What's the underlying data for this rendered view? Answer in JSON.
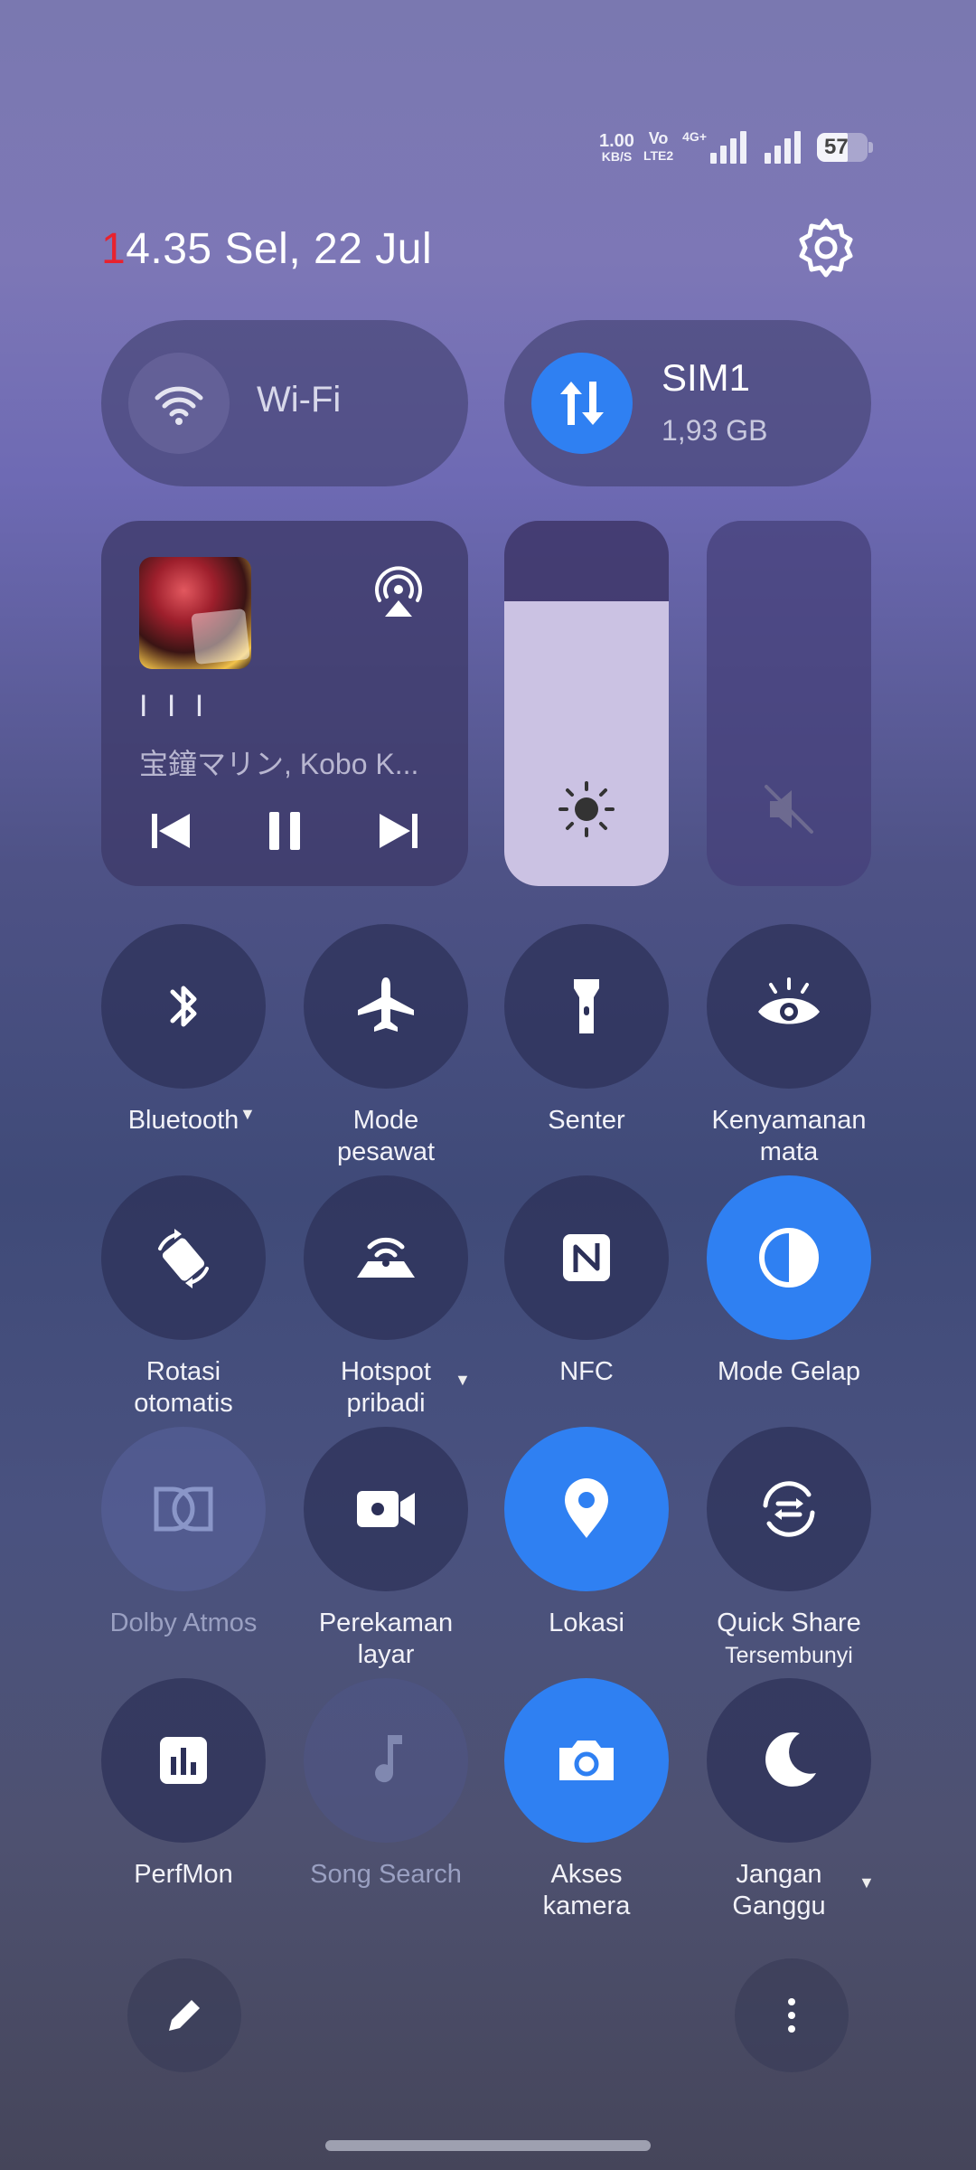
{
  "status_bar": {
    "speed_value": "1.00",
    "speed_unit": "KB/S",
    "volte_top": "Vo",
    "volte_bottom": "LTE2",
    "network": "4G+",
    "battery": "57"
  },
  "header": {
    "time_first_digit": "1",
    "time_rest": "4.35",
    "date": "Sel, 22 Jul"
  },
  "wifi": {
    "label": "Wi-Fi"
  },
  "sim": {
    "title": "SIM1",
    "usage": "1,93 GB"
  },
  "media": {
    "title": "I I I",
    "artist": "宝鐘マリン, Kobo K..."
  },
  "sliders": {
    "brightness_level": 0.78
  },
  "tiles": {
    "bluetooth": "Bluetooth",
    "airplane_1": "Mode",
    "airplane_2": "pesawat",
    "flashlight": "Senter",
    "eye_1": "Kenyamanan",
    "eye_2": "mata",
    "rotate_1": "Rotasi",
    "rotate_2": "otomatis",
    "hotspot_1": "Hotspot",
    "hotspot_2": "pribadi",
    "nfc": "NFC",
    "dark": "Mode Gelap",
    "dolby": "Dolby Atmos",
    "record_1": "Perekaman",
    "record_2": "layar",
    "location": "Lokasi",
    "share_1": "Quick Share",
    "share_2": "Tersembunyi",
    "perfmon": "PerfMon",
    "song": "Song Search",
    "camera_1": "Akses",
    "camera_2": "kamera",
    "dnd_1": "Jangan",
    "dnd_2": "Ganggu"
  },
  "colors": {
    "accent": "#2f80f2",
    "clock_red": "#e8222e"
  },
  "icons": [
    "wifi-icon",
    "data-icon",
    "cast-icon",
    "previous-icon",
    "pause-icon",
    "next-icon",
    "brightness-icon",
    "mute-icon",
    "bluetooth-icon",
    "airplane-icon",
    "flashlight-icon",
    "eye-icon",
    "rotate-icon",
    "hotspot-icon",
    "nfc-icon",
    "dark-mode-icon",
    "dolby-icon",
    "screen-record-icon",
    "location-icon",
    "quick-share-icon",
    "perfmon-icon",
    "music-note-icon",
    "camera-icon",
    "moon-icon",
    "pencil-icon",
    "more-icon",
    "gear-icon"
  ]
}
